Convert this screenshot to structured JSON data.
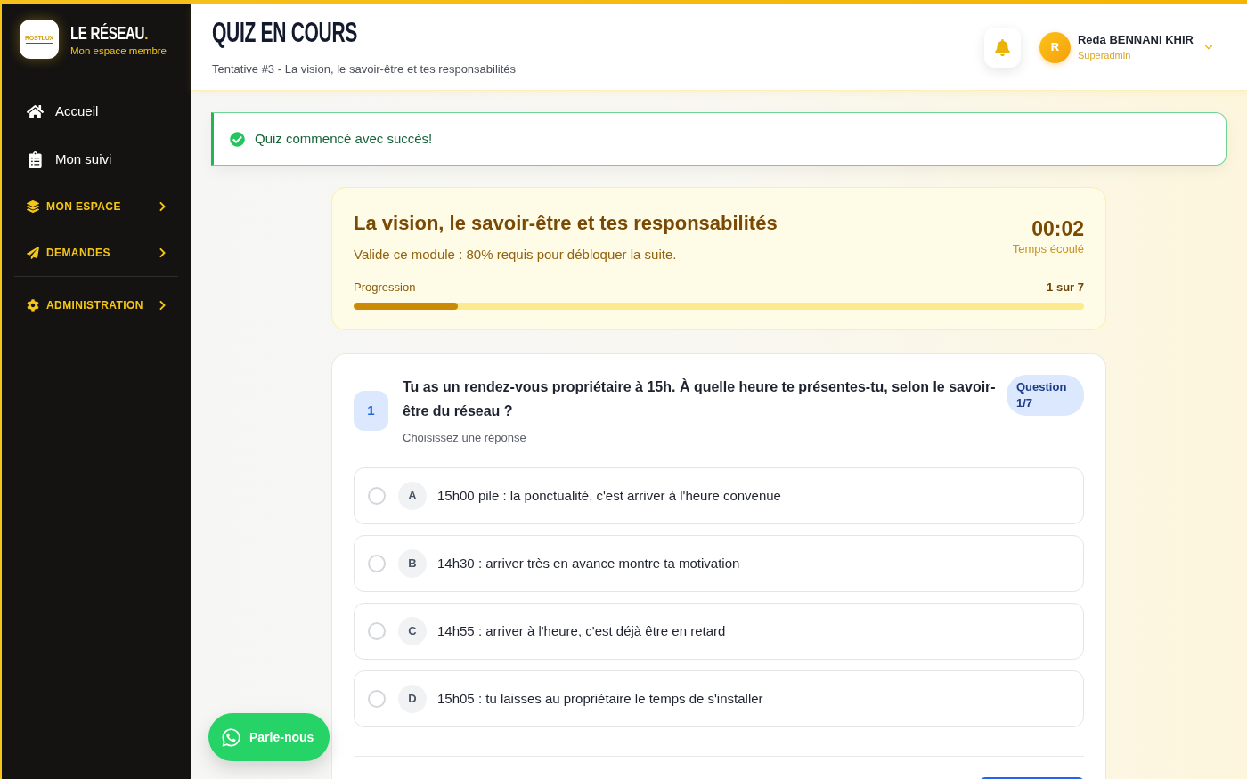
{
  "sidebar": {
    "brand": {
      "logo_text": "ROSTLUX",
      "name": "LE RÉSEAU.",
      "tagline": "Mon espace membre"
    },
    "groups": [
      {
        "items": [
          {
            "kind": "link",
            "label": "Accueil"
          },
          {
            "kind": "link",
            "label": "Mon suivi"
          },
          {
            "kind": "section",
            "label": "MON ESPACE",
            "expanded": false
          },
          {
            "kind": "section",
            "label": "DEMANDES",
            "expanded": false
          }
        ]
      },
      {
        "items": [
          {
            "kind": "section",
            "label": "ADMINISTRATION",
            "expanded": false
          }
        ]
      }
    ]
  },
  "header": {
    "title": "QUIZ EN COURS",
    "subtitle": "Tentative #3 - La vision, le savoir-être et tes responsabilités",
    "user": {
      "initial": "R",
      "name": "Reda BENNANI KHIR",
      "role": "Superadmin"
    }
  },
  "alert": {
    "kind": "success",
    "message": "Quiz commencé avec succès!"
  },
  "module": {
    "title": "La vision, le savoir-être et tes responsabilités",
    "requirement": "Valide ce module : 80% requis pour débloquer la suite.",
    "timer": "00:02",
    "timer_label": "Temps écoulé",
    "progress": {
      "label": "Progression",
      "reading": "1 sur 7",
      "level": 0.143
    }
  },
  "question": {
    "number": "1",
    "text": "Tu as un rendez-vous propriétaire à 15h. À quelle heure te présentes-tu, selon le savoir-être du réseau ?",
    "badge": "Question 1/7",
    "hint": "Choisissez une réponse",
    "options": [
      {
        "letter": "A",
        "text": "15h00 pile : la ponctualité, c'est arriver à l'heure convenue",
        "selected": false
      },
      {
        "letter": "B",
        "text": "14h30 : arriver très en avance montre ta motivation",
        "selected": false
      },
      {
        "letter": "C",
        "text": "14h55 : arriver à l'heure, c'est déjà être en retard",
        "selected": false
      },
      {
        "letter": "D",
        "text": "15h05 : tu laisses au propriétaire le temps de s'installer",
        "selected": false
      }
    ]
  },
  "chat_button": {
    "label": "Parle-nous"
  }
}
